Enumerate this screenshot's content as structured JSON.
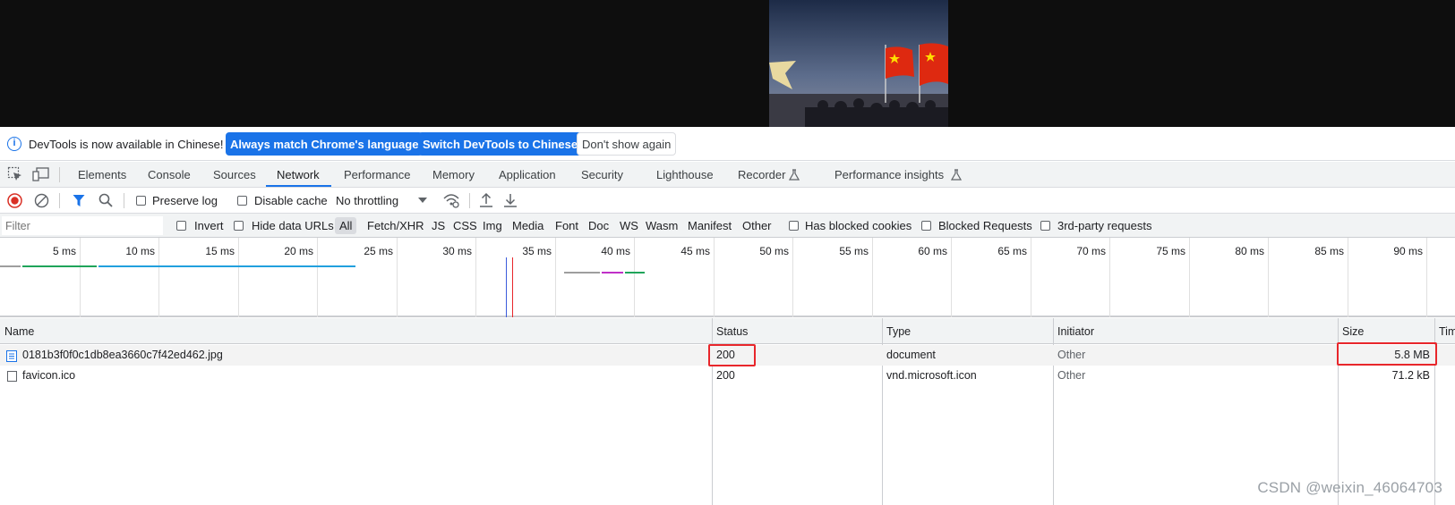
{
  "infobar": {
    "message": "DevTools is now available in Chinese!",
    "btn_match": "Always match Chrome's language",
    "btn_switch": "Switch DevTools to Chinese",
    "btn_dismiss": "Don't show again"
  },
  "tabs": [
    "Elements",
    "Console",
    "Sources",
    "Network",
    "Performance",
    "Memory",
    "Application",
    "Security",
    "Lighthouse",
    "Recorder",
    "Performance insights"
  ],
  "active_tab": "Network",
  "toolbar": {
    "preserve_log": "Preserve log",
    "disable_cache": "Disable cache",
    "throttling": "No throttling"
  },
  "filterbar": {
    "placeholder": "Filter",
    "invert": "Invert",
    "hide_data_urls": "Hide data URLs",
    "types": [
      "All",
      "Fetch/XHR",
      "JS",
      "CSS",
      "Img",
      "Media",
      "Font",
      "Doc",
      "WS",
      "Wasm",
      "Manifest",
      "Other"
    ],
    "has_blocked_cookies": "Has blocked cookies",
    "blocked_requests": "Blocked Requests",
    "third_party": "3rd-party requests"
  },
  "overview": {
    "ticks": [
      "5 ms",
      "10 ms",
      "15 ms",
      "20 ms",
      "25 ms",
      "30 ms",
      "35 ms",
      "40 ms",
      "45 ms",
      "50 ms",
      "55 ms",
      "60 ms",
      "65 ms",
      "70 ms",
      "75 ms",
      "80 ms",
      "85 ms",
      "90 ms"
    ]
  },
  "table": {
    "columns": [
      "Name",
      "Status",
      "Type",
      "Initiator",
      "Size",
      "Tim"
    ],
    "rows": [
      {
        "name": "0181b3f0f0c1db8ea3660c7f42ed462.jpg",
        "status": "200",
        "type": "document",
        "initiator": "Other",
        "size": "5.8 MB"
      },
      {
        "name": "favicon.ico",
        "status": "200",
        "type": "vnd.microsoft.icon",
        "initiator": "Other",
        "size": "71.2 kB"
      }
    ]
  },
  "watermark": "CSDN @weixin_46064703",
  "colors": {
    "accent": "#1a73e8",
    "highlight": "#e8262b",
    "record": "#d93025"
  }
}
